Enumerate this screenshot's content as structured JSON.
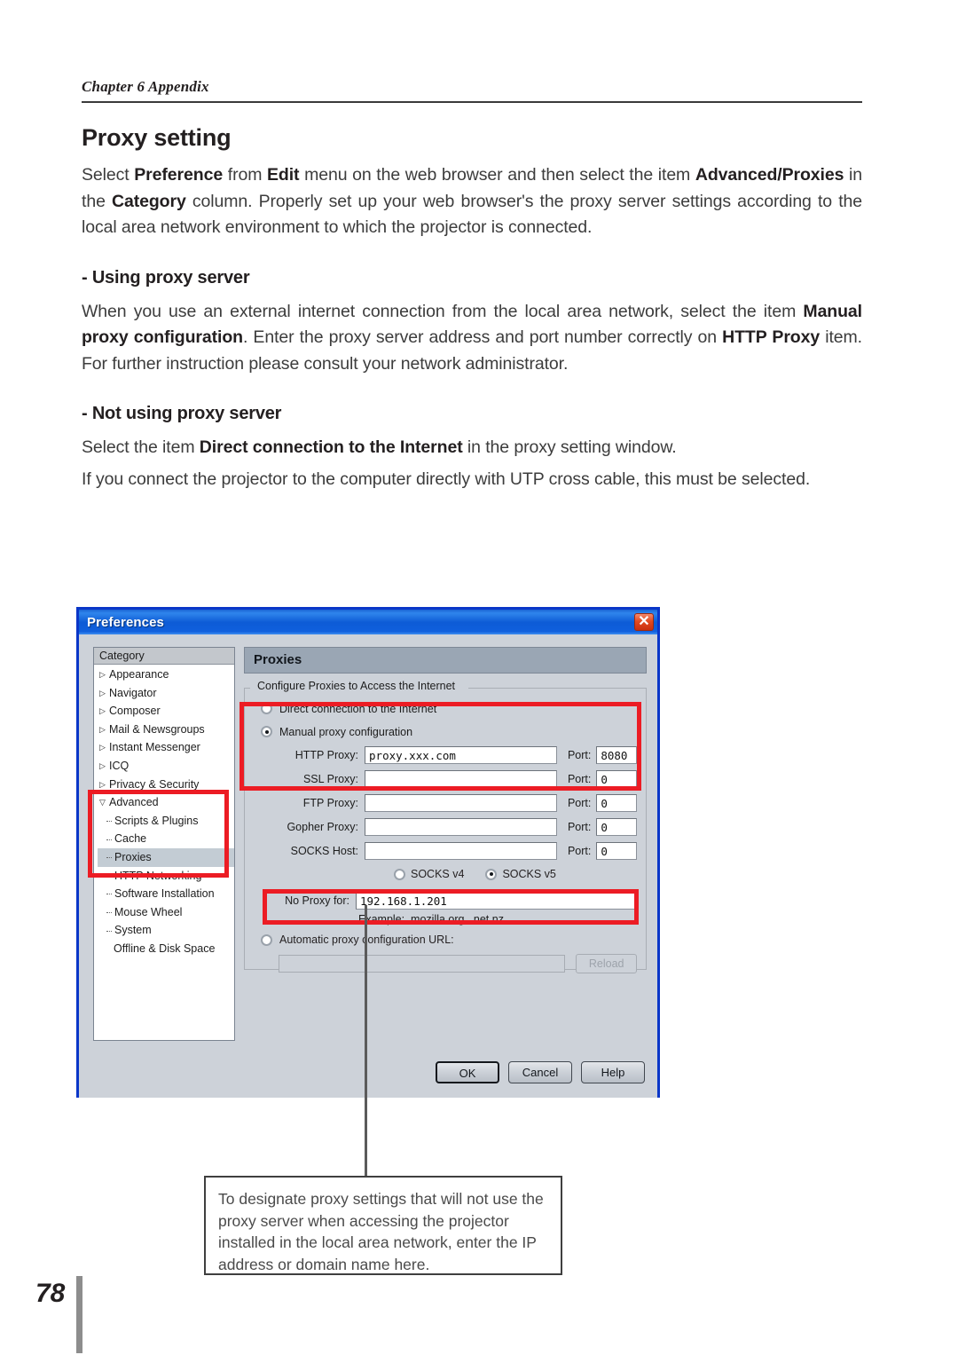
{
  "header": {
    "chapter": "Chapter 6 Appendix"
  },
  "main": {
    "title": "Proxy setting",
    "intro_line1_a": "Select ",
    "intro_b1": "Preference",
    "intro_line1_b": " from ",
    "intro_b2": "Edit",
    "intro_line1_c": " menu on the web browser and then select the item ",
    "intro_b3": "Advanced/",
    "intro_b4": "Proxies",
    "intro_line2_a": " in the ",
    "intro_b5": "Category",
    "intro_line2_b": " column. Properly set up your web browser's the proxy server settings according to the local area network environment to which the projector is connected.",
    "sub1_title": "- Using proxy server",
    "sub1_a": "When you use an external internet connection from the local area network, select the item ",
    "sub1_b1": "Manual proxy configuration",
    "sub1_c": ". Enter the proxy server address and port number correctly on ",
    "sub1_b2": "HTTP Proxy",
    "sub1_d": " item. For further instruction please consult your network administrator.",
    "sub2_title": "- Not using proxy server",
    "sub2_a": "Select the item ",
    "sub2_b1": "Direct connection to the Internet",
    "sub2_b": " in the proxy setting window.",
    "sub2_c": "If you connect the projector to the computer directly with UTP cross cable, this must be selected."
  },
  "dialog": {
    "title": "Preferences",
    "close_icon": "✕",
    "category_header": "Category",
    "tree": [
      {
        "label": "Appearance",
        "type": "expandable",
        "marker": "▷"
      },
      {
        "label": "Navigator",
        "type": "expandable",
        "marker": "▷"
      },
      {
        "label": "Composer",
        "type": "expandable",
        "marker": "▷"
      },
      {
        "label": "Mail & Newsgroups",
        "type": "expandable",
        "marker": "▷"
      },
      {
        "label": "Instant Messenger",
        "type": "expandable",
        "marker": "▷"
      },
      {
        "label": "ICQ",
        "type": "expandable",
        "marker": "▷"
      },
      {
        "label": "Privacy & Security",
        "type": "expandable",
        "marker": "▷"
      },
      {
        "label": "Advanced",
        "type": "expanded",
        "marker": "▽"
      },
      {
        "label": "Scripts & Plugins",
        "type": "child"
      },
      {
        "label": "Cache",
        "type": "child"
      },
      {
        "label": "Proxies",
        "type": "child",
        "selected": true
      },
      {
        "label": "HTTP Networking",
        "type": "child"
      },
      {
        "label": "Software Installation",
        "type": "child"
      },
      {
        "label": "Mouse Wheel",
        "type": "child"
      },
      {
        "label": "System",
        "type": "child"
      },
      {
        "label": "Offline & Disk Space",
        "type": "plain"
      }
    ],
    "panel_title": "Proxies",
    "fieldset_legend": "Configure Proxies to Access the Internet",
    "radio_direct": "Direct connection to the Internet",
    "radio_manual": "Manual proxy configuration",
    "fields": [
      {
        "label": "HTTP Proxy:",
        "underline": "H",
        "value": "proxy.xxx.com",
        "port_label": "Port:",
        "port_underline": "P",
        "port_value": "8080"
      },
      {
        "label": "SSL Proxy:",
        "underline": "S",
        "value": "",
        "port_label": "Port:",
        "port_underline": "o",
        "port_value": "0"
      },
      {
        "label": "FTP Proxy:",
        "underline": "F",
        "value": "",
        "port_label": "Port:",
        "port_underline": "r",
        "port_value": "0"
      },
      {
        "label": "Gopher Proxy:",
        "underline": "G",
        "value": "",
        "port_label": "Port:",
        "port_underline": "",
        "port_value": "0"
      },
      {
        "label": "SOCKS Host:",
        "underline": "C",
        "value": "",
        "port_label": "Port:",
        "port_underline": "t",
        "port_value": "0"
      }
    ],
    "socks_v4": "SOCKS v4",
    "socks_v5": "SOCKS v5",
    "noproxy_label": "No Proxy for:",
    "noproxy_value": "192.168.1.201",
    "example_text": "Example: .mozilla.org, .net.nz",
    "auto_label": "Automatic proxy configuration URL:",
    "auto_value": "",
    "reload_label": "Reload",
    "btn_ok": "OK",
    "btn_cancel": "Cancel",
    "btn_help": "Help"
  },
  "callout": {
    "text": "To designate proxy settings that will not use the proxy server when accessing the projector installed in the local area network, enter the IP address or domain name here."
  },
  "page": {
    "number": "78"
  },
  "colors": {
    "annotation_red": "#ec1c24",
    "titlebar_blue": "#0d5bd6",
    "dialog_face": "#cdd2d9"
  }
}
